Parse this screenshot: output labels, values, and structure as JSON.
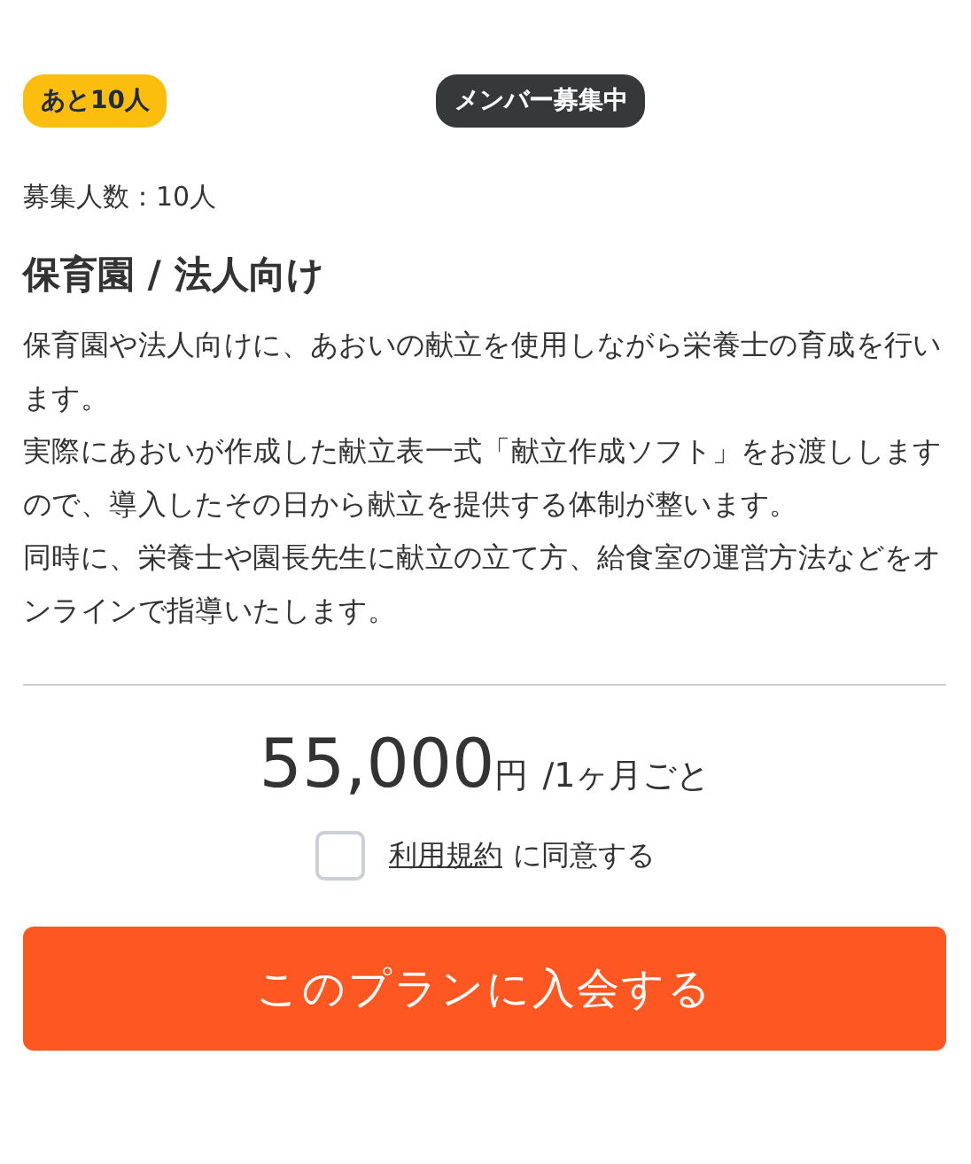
{
  "badges": {
    "remaining": "あと10人",
    "status": "メンバー募集中"
  },
  "capacity": "募集人数：10人",
  "title": "保育園 / 法人向け",
  "description": [
    "保育園や法人向けに、あおいの献立を使用しながら栄養士の育成を行います。",
    "実際にあおいが作成した献立表一式「献立作成ソフト」をお渡ししますので、導入したその日から献立を提供する体制が整います。",
    "同時に、栄養士や園長先生に献立の立て方、給食室の運営方法などをオンラインで指導いたします。"
  ],
  "price": {
    "amount": "55,000",
    "unit": "円",
    "period": "/1ヶ月ごと"
  },
  "agreement": {
    "checked": false,
    "link": "利用規約",
    "text": "に同意する"
  },
  "join_button": "このプランに入会する"
}
